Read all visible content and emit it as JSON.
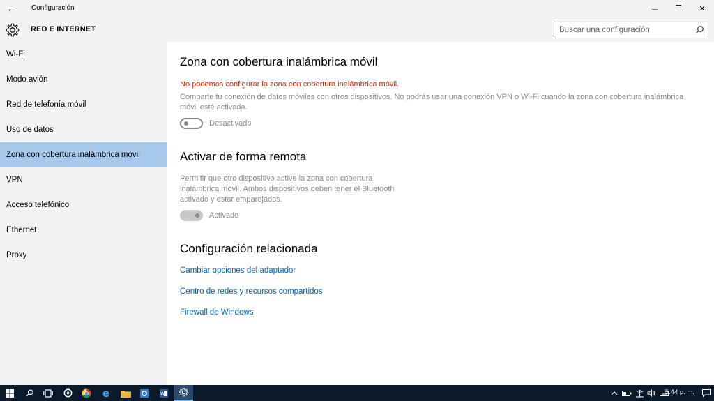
{
  "window": {
    "title": "Configuración",
    "back_glyph": "←",
    "minimize_glyph": "—",
    "restore_glyph": "❐",
    "close_glyph": "✕"
  },
  "header": {
    "section_title": "RED E INTERNET",
    "search_placeholder": "Buscar una configuración"
  },
  "sidebar": {
    "items": [
      {
        "label": "Wi-Fi",
        "active": false
      },
      {
        "label": "Modo avión",
        "active": false
      },
      {
        "label": "Red de telefonía móvil",
        "active": false
      },
      {
        "label": "Uso de datos",
        "active": false
      },
      {
        "label": "Zona con cobertura inalámbrica móvil",
        "active": true
      },
      {
        "label": "VPN",
        "active": false
      },
      {
        "label": "Acceso telefónico",
        "active": false
      },
      {
        "label": "Ethernet",
        "active": false
      },
      {
        "label": "Proxy",
        "active": false
      }
    ],
    "active_color": "#a6c8ea"
  },
  "main": {
    "hotspot": {
      "title": "Zona con cobertura inalámbrica móvil",
      "error": "No podemos configurar la zona con cobertura inalámbrica móvil.",
      "description_line1": "Comparte tu conexión de datos móviles con otros dispositivos. No podrás usar una conexión VPN o Wi-Fi cuando la zona con cobertura inalámbrica",
      "description_line2": "móvil esté activada.",
      "toggle_state": "off",
      "toggle_label": "Desactivado"
    },
    "remote": {
      "title": "Activar de forma remota",
      "description_line1": "Permitir que otro dispositivo active la zona con cobertura",
      "description_line2": "inalámbrica móvil. Ambos dispositivos deben tener el Bluetooth",
      "description_line3": "activado y estar emparejados.",
      "toggle_state": "on",
      "toggle_label": "Activado"
    },
    "related": {
      "title": "Configuración relacionada",
      "links": [
        "Cambiar opciones del adaptador",
        "Centro de redes y recursos compartidos",
        "Firewall de Windows"
      ]
    },
    "error_color": "#d02d05",
    "link_color": "#0063b1"
  },
  "taskbar": {
    "icons": [
      "windows-start-icon",
      "search-icon",
      "task-view-icon",
      "media-icon",
      "chrome-icon",
      "edge-icon",
      "file-explorer-icon",
      "store-icon",
      "word-icon",
      "settings-icon"
    ],
    "active_icon": "settings-icon",
    "clock": "5:44 p. m."
  }
}
